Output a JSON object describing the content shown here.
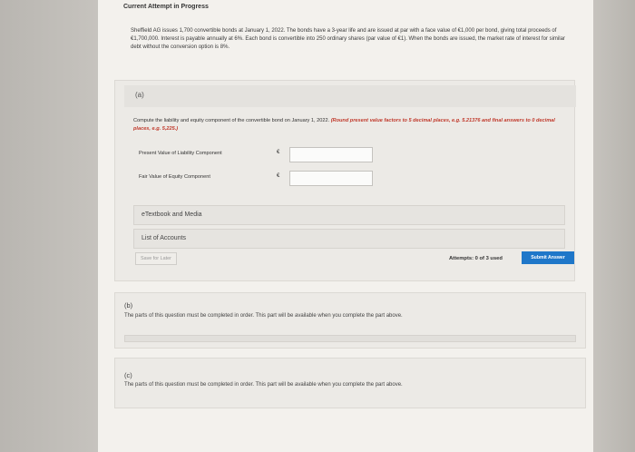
{
  "header": {
    "title": "Current Attempt in Progress"
  },
  "problem": {
    "text": "Sheffield AG issues 1,700 convertible bonds at January 1, 2022. The bonds have a 3-year life and are issued at par with a face value of €1,000 per bond, giving total proceeds of €1,700,000. Interest is payable annually at 6%. Each bond is convertible into 250 ordinary shares (par value of €1). When the bonds are issued, the market rate of interest for similar debt without the conversion option is 8%."
  },
  "part_a": {
    "label": "(a)",
    "instruction": "Compute the liability and equity component of the convertible bond on January 1, 2022.",
    "instruction_red": "(Round present value factors to 5 decimal places, e.g. 5.21376 and final answers to 0 decimal places, e.g. 5,225.)",
    "fields": [
      {
        "label": "Present Value of Liability Component",
        "currency": "€",
        "value": ""
      },
      {
        "label": "Fair Value of Equity Component",
        "currency": "€",
        "value": ""
      }
    ],
    "resources": [
      {
        "label": "eTextbook and Media"
      },
      {
        "label": "List of Accounts"
      }
    ],
    "save_later": "Save for Later",
    "attempts": "Attempts: 0 of 3 used",
    "submit": "Submit Answer"
  },
  "part_b": {
    "label": "(b)",
    "text": "The parts of this question must be completed in order. This part will be available when you complete the part above."
  },
  "part_c": {
    "label": "(c)",
    "text": "The parts of this question must be completed in order. This part will be available when you complete the part above."
  }
}
